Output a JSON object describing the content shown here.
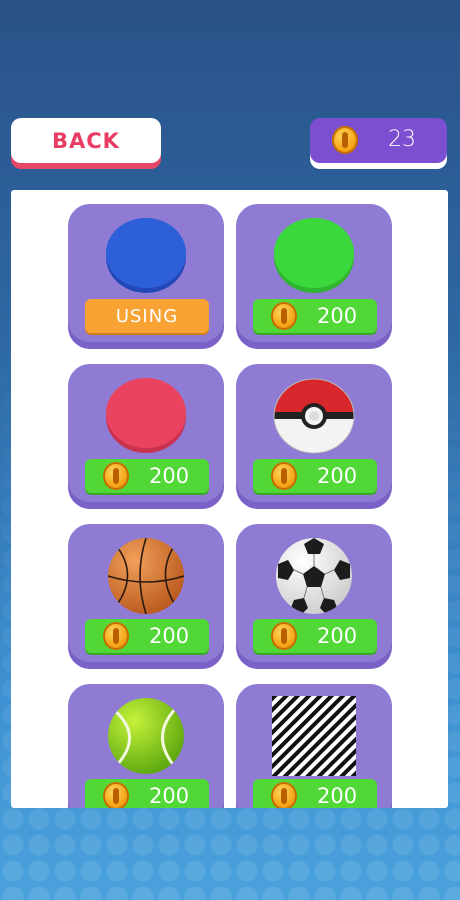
{
  "header": {
    "back_label": "BACK",
    "coins": "23"
  },
  "shop": {
    "items": [
      {
        "name": "blue-ball",
        "status": "USING",
        "color": "#2d5fd8"
      },
      {
        "name": "green-ball",
        "price": "200",
        "color": "#3bd83b"
      },
      {
        "name": "red-ball",
        "price": "200",
        "color": "#e94360"
      },
      {
        "name": "pokeball",
        "price": "200"
      },
      {
        "name": "basketball",
        "price": "200"
      },
      {
        "name": "soccer-ball",
        "price": "200"
      },
      {
        "name": "tennis-ball",
        "price": "200"
      },
      {
        "name": "striped-ball",
        "price": "200"
      }
    ]
  },
  "colors": {
    "back_text": "#e93c63",
    "coin_box": "#7c4fd0",
    "card": "#8f7bd4",
    "price_button": "#51d836",
    "using_button": "#f8a334"
  }
}
